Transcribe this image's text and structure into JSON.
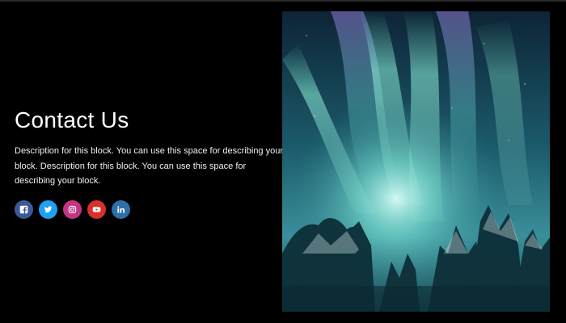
{
  "contact": {
    "title": "Contact Us",
    "description": "Description for this block. You can use this space for describing your block. Description for this block. You can use this space for describing your block."
  },
  "socials": [
    {
      "name": "facebook",
      "icon": "facebook-icon",
      "color": "#3b5998"
    },
    {
      "name": "twitter",
      "icon": "twitter-icon",
      "color": "#1da1f2"
    },
    {
      "name": "instagram",
      "icon": "instagram-icon",
      "color": "#c13584"
    },
    {
      "name": "youtube",
      "icon": "youtube-icon",
      "color": "#d9302a"
    },
    {
      "name": "linkedin",
      "icon": "linkedin-icon",
      "color": "#2f6fa8"
    }
  ],
  "image": {
    "subject": "aurora-over-snowy-forest",
    "colors": {
      "sky_top": "#0b2233",
      "sky_glow": "#62d6c8",
      "trees": "#0c2b34"
    }
  }
}
